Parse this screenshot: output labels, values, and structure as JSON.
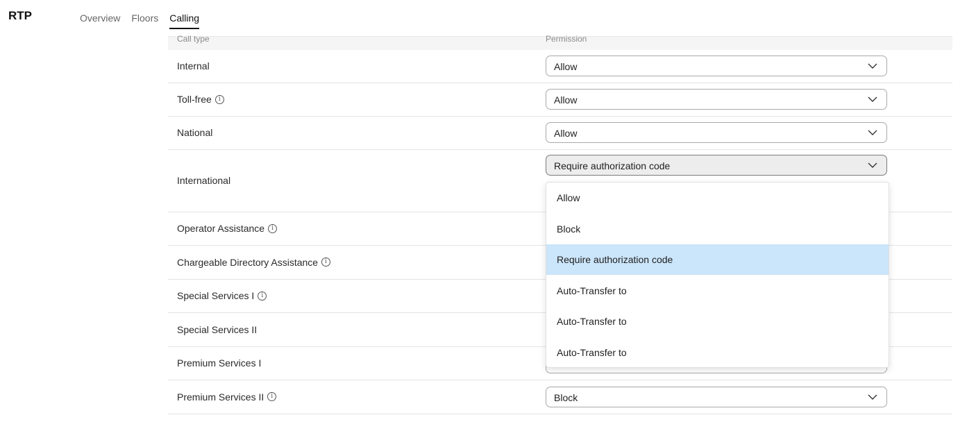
{
  "header": {
    "title": "RTP",
    "tabs": [
      {
        "label": "Overview"
      },
      {
        "label": "Floors"
      },
      {
        "label": "Calling"
      }
    ]
  },
  "table": {
    "col_call_type": "Call type",
    "col_permission": "Permission",
    "rows": [
      {
        "call_type": "Internal",
        "permission": "Allow",
        "info": false
      },
      {
        "call_type": "Toll-free",
        "permission": "Allow",
        "info": true
      },
      {
        "call_type": "National",
        "permission": "Allow",
        "info": false
      },
      {
        "call_type": "International",
        "permission": "Require authorization code",
        "info": false,
        "open": true
      },
      {
        "call_type": "Operator Assistance",
        "permission": "",
        "info": true
      },
      {
        "call_type": "Chargeable Directory Assistance",
        "permission": "",
        "info": true
      },
      {
        "call_type": "Special Services I",
        "permission": "",
        "info": true
      },
      {
        "call_type": "Special Services II",
        "permission": "",
        "info": false
      },
      {
        "call_type": "Premium Services I",
        "permission": "",
        "info": false
      },
      {
        "call_type": "Premium Services II",
        "permission": "Block",
        "info": true
      }
    ]
  },
  "dropdown": {
    "options": [
      {
        "label": "Allow"
      },
      {
        "label": "Block"
      },
      {
        "label": "Require authorization code",
        "selected": true
      },
      {
        "label": "Auto-Transfer to"
      },
      {
        "label": "Auto-Transfer to"
      },
      {
        "label": "Auto-Transfer to"
      }
    ]
  },
  "icons": {
    "info": "info-circle-icon",
    "chevron": "chevron-down-icon"
  },
  "colors": {
    "selected_option": "#cbe5fa",
    "open_select_bg": "#ededed"
  }
}
